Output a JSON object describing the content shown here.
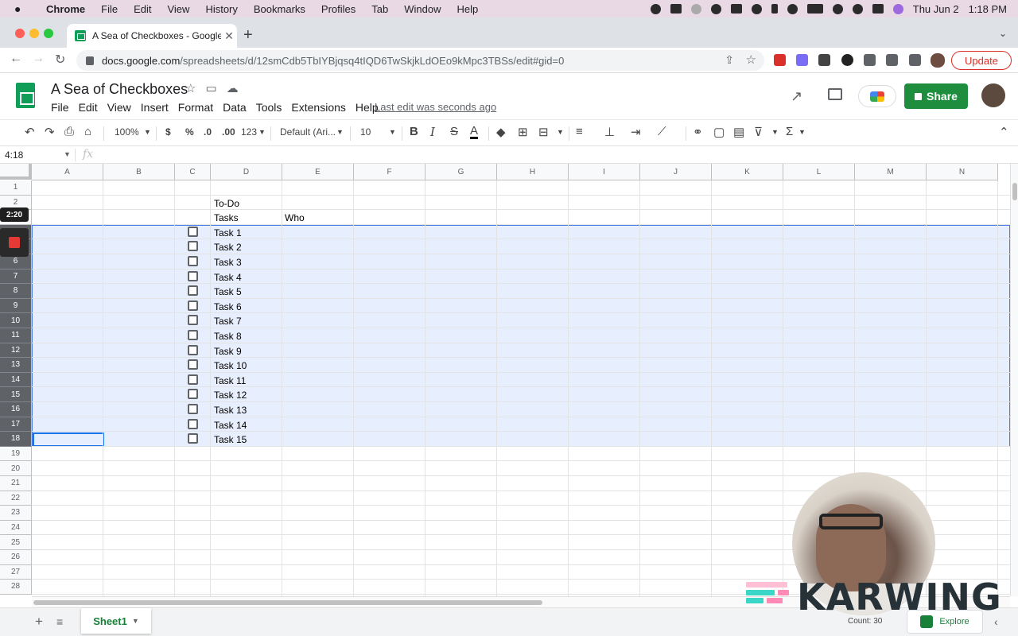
{
  "macos_menubar": {
    "apple": "",
    "app": "Chrome",
    "items": [
      "File",
      "Edit",
      "View",
      "History",
      "Bookmarks",
      "Profiles",
      "Tab",
      "Window",
      "Help"
    ],
    "date": "Thu Jun 2",
    "time": "1:18 PM"
  },
  "browser": {
    "tab_title": "A Sea of Checkboxes - Google",
    "tab_close": "✕",
    "new_tab": "+",
    "url_host": "docs.google.com",
    "url_path": "/spreadsheets/d/12smCdb5TbIYBjqsq4tIQD6TwSkjkLdOEo9kMpc3TBSs/edit#gid=0",
    "update_label": "Update"
  },
  "doc": {
    "title": "A Sea of Checkboxes",
    "menu": [
      "File",
      "Edit",
      "View",
      "Insert",
      "Format",
      "Data",
      "Tools",
      "Extensions",
      "Help"
    ],
    "last_edit": "Last edit was seconds ago",
    "share_label": "Share"
  },
  "toolbar": {
    "zoom": "100%",
    "currency": "$",
    "percent": "%",
    "dec_decrease": ".0",
    "dec_increase": ".00",
    "number_format": "123",
    "font": "Default (Ari...",
    "font_size": "10",
    "bold": "B",
    "italic": "I",
    "strike": "S",
    "text_color": "A",
    "sum": "Σ"
  },
  "formula_bar": {
    "name_box": "4:18",
    "fx": "fx"
  },
  "grid": {
    "columns": [
      "A",
      "B",
      "C",
      "D",
      "E",
      "F",
      "G",
      "H",
      "I",
      "J",
      "K",
      "L",
      "M",
      "N"
    ],
    "rows": [
      "1",
      "2",
      "3",
      "4",
      "5",
      "6",
      "7",
      "8",
      "9",
      "10",
      "11",
      "12",
      "13",
      "14",
      "15",
      "16",
      "17",
      "18",
      "19",
      "20",
      "21",
      "22",
      "23",
      "24",
      "25",
      "26",
      "27",
      "28"
    ],
    "selected_rows": "4:18",
    "cells": {
      "D2": "To-Do",
      "D3": "Tasks",
      "E3": "Who"
    },
    "tasks": [
      "Task 1",
      "Task 2",
      "Task 3",
      "Task 4",
      "Task 5",
      "Task 6",
      "Task 7",
      "Task 8",
      "Task 9",
      "Task 10",
      "Task 11",
      "Task 12",
      "Task 13",
      "Task 14",
      "Task 15"
    ],
    "checkboxes_checked": [
      false,
      false,
      false,
      false,
      false,
      false,
      false,
      false,
      false,
      false,
      false,
      false,
      false,
      false,
      false
    ]
  },
  "sheets": {
    "add": "+",
    "all": "≡",
    "active_tab": "Sheet1",
    "count_label": "Count: 30",
    "explore_label": "Explore",
    "collapse": "‹"
  },
  "recording": {
    "timer": "2:20"
  },
  "watermark": {
    "text": "KARWING"
  },
  "colors": {
    "accent": "#1a73e8",
    "selection": "#e8f0fe",
    "share_green": "#1e8e3e",
    "update_red": "#d93025"
  }
}
